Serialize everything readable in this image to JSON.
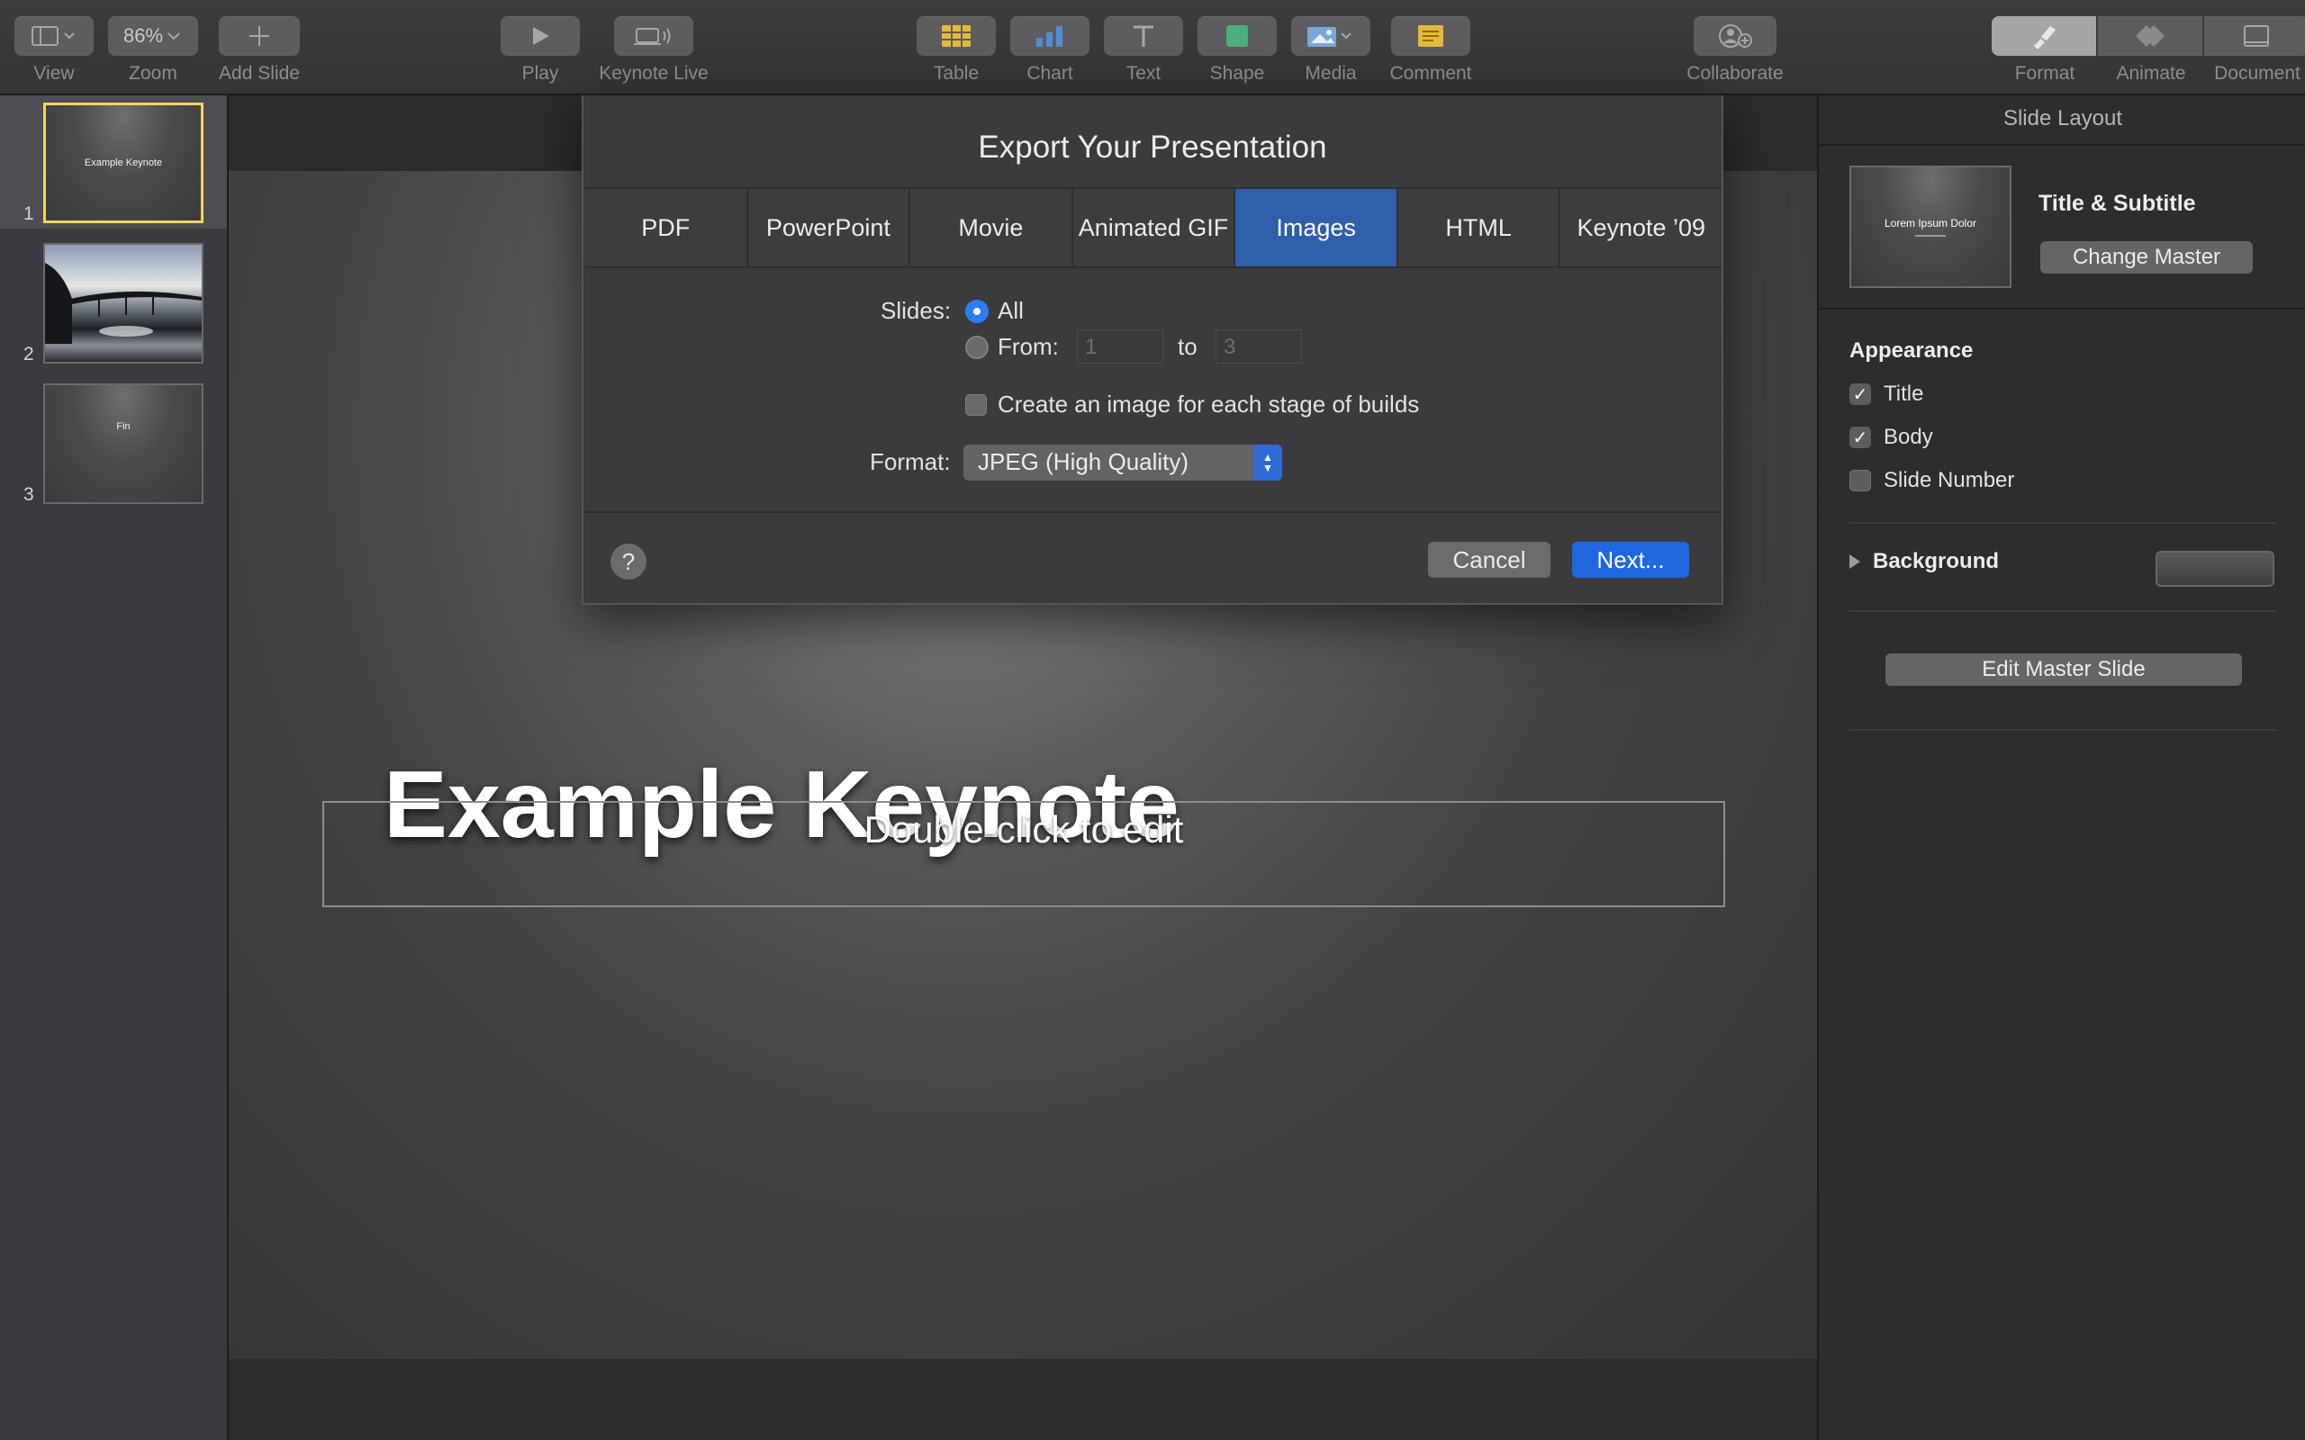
{
  "toolbar": {
    "view_label": "View",
    "zoom_value": "86%",
    "zoom_label": "Zoom",
    "add_slide_label": "Add Slide",
    "play_label": "Play",
    "keynote_live_label": "Keynote Live",
    "table_label": "Table",
    "chart_label": "Chart",
    "text_label": "Text",
    "shape_label": "Shape",
    "media_label": "Media",
    "comment_label": "Comment",
    "collaborate_label": "Collaborate",
    "format_label": "Format",
    "animate_label": "Animate",
    "document_label": "Document",
    "icon_colors": {
      "table": "#e6b93a",
      "chart": "#4d8fd1",
      "shape": "#4bb07a",
      "comment": "#e6b93a"
    }
  },
  "navigator": {
    "slides": [
      {
        "number": "1",
        "text": "Example Keynote",
        "selected": true
      },
      {
        "number": "2",
        "text": "",
        "selected": false
      },
      {
        "number": "3",
        "text": "Fin",
        "selected": false
      }
    ]
  },
  "slide": {
    "title": "Example Keynote",
    "body_placeholder": "Double-click to edit"
  },
  "export_dialog": {
    "title": "Export Your Presentation",
    "tabs": [
      "PDF",
      "PowerPoint",
      "Movie",
      "Animated GIF",
      "Images",
      "HTML",
      "Keynote ’09"
    ],
    "active_tab": "Images",
    "slides_label": "Slides:",
    "all_label": "All",
    "from_label": "From:",
    "from_value": "1",
    "to_label": "to",
    "to_value": "3",
    "builds_label": "Create an image for each stage of builds",
    "format_label": "Format:",
    "format_value": "JPEG (High Quality)",
    "help_label": "?",
    "cancel_label": "Cancel",
    "next_label": "Next..."
  },
  "inspector": {
    "header": "Slide Layout",
    "master_thumb_text": "Lorem Ipsum Dolor",
    "master_name": "Title & Subtitle",
    "change_master_label": "Change Master",
    "appearance_label": "Appearance",
    "title_label": "Title",
    "title_checked": true,
    "body_label": "Body",
    "body_checked": true,
    "slide_number_label": "Slide Number",
    "slide_number_checked": false,
    "background_label": "Background",
    "edit_master_label": "Edit Master Slide"
  }
}
